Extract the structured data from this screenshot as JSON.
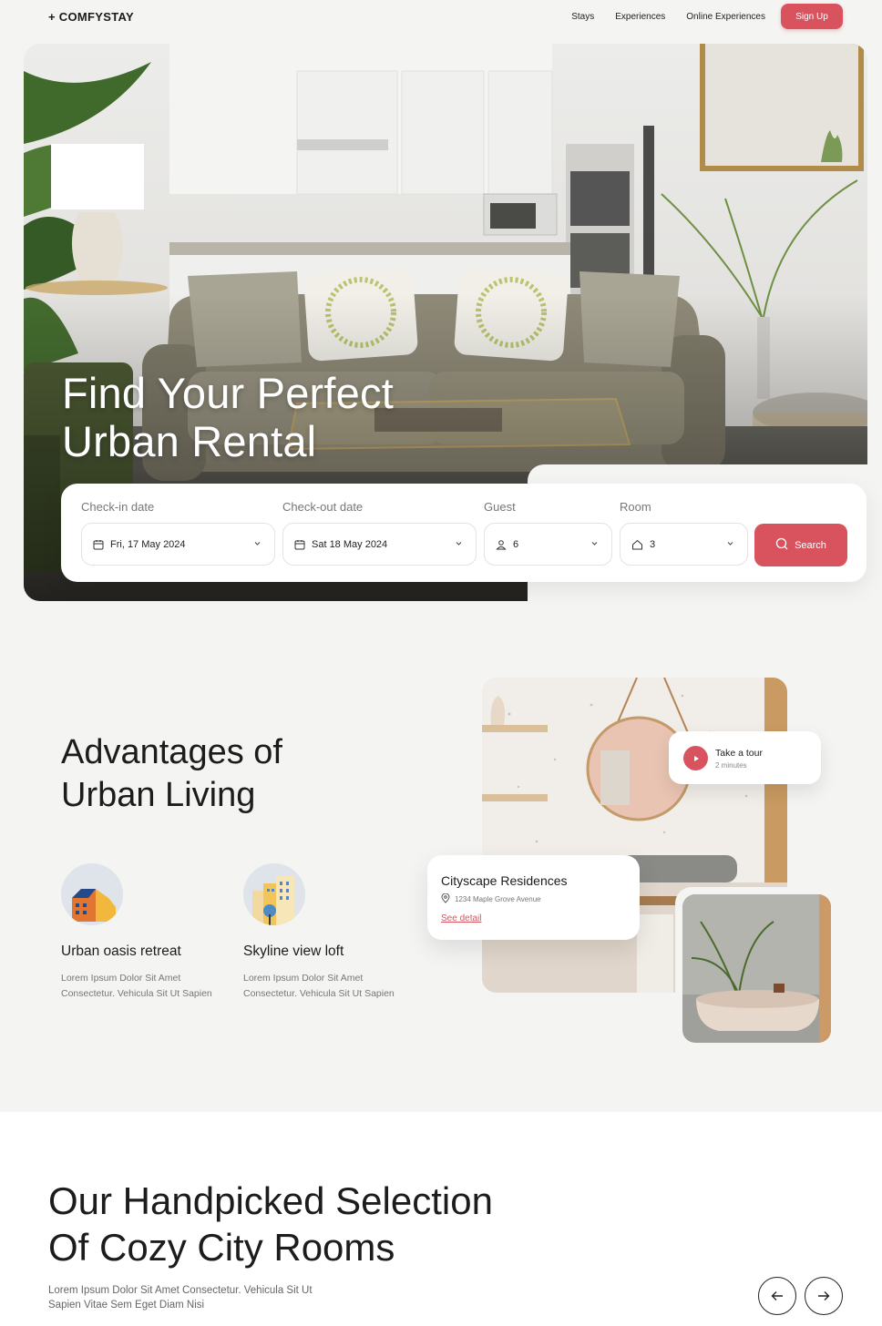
{
  "nav": {
    "logo": "+ COMFYSTAY",
    "links": [
      "Stays",
      "Experiences",
      "Online Experiences"
    ],
    "signup": "Sign Up"
  },
  "hero": {
    "title_line1": "Find Your Perfect",
    "title_line2": "Urban Rental"
  },
  "booking": {
    "checkin_label": "Check-in date",
    "checkin_value": "Fri, 17 May 2024",
    "checkout_label": "Check-out date",
    "checkout_value": "Sat 18 May 2024",
    "guest_label": "Guest",
    "guest_value": "6",
    "room_label": "Room",
    "room_value": "3",
    "search_label": "Search"
  },
  "advantages": {
    "title_line1": "Advantages of",
    "title_line2": "Urban Living",
    "features": [
      {
        "name": "Urban oasis retreat",
        "desc_line1": "Lorem Ipsum Dolor Sit Amet",
        "desc_line2": "Consectetur. Vehicula Sit Ut Sapien",
        "icon": "house-icon"
      },
      {
        "name": "Skyline view loft",
        "desc_line1": "Lorem Ipsum Dolor Sit Amet",
        "desc_line2": "Consectetur. Vehicula Sit Ut Sapien",
        "icon": "skyline-icon"
      }
    ]
  },
  "tour": {
    "title": "Take a tour",
    "duration": "2 minutes"
  },
  "property_card": {
    "name": "Cityscape Residences",
    "address": "1234 Maple Grove Avenue",
    "link": "See detail"
  },
  "selection": {
    "title_line1": "Our Handpicked Selection",
    "title_line2": "Of Cozy City Rooms",
    "desc": "Lorem Ipsum Dolor Sit Amet Consectetur. Vehicula Sit Ut Sapien Vitae Sem Eget Diam Nisi"
  },
  "colors": {
    "accent": "#d9535f",
    "background": "#f4f4f2",
    "text": "#1c1c1c"
  }
}
